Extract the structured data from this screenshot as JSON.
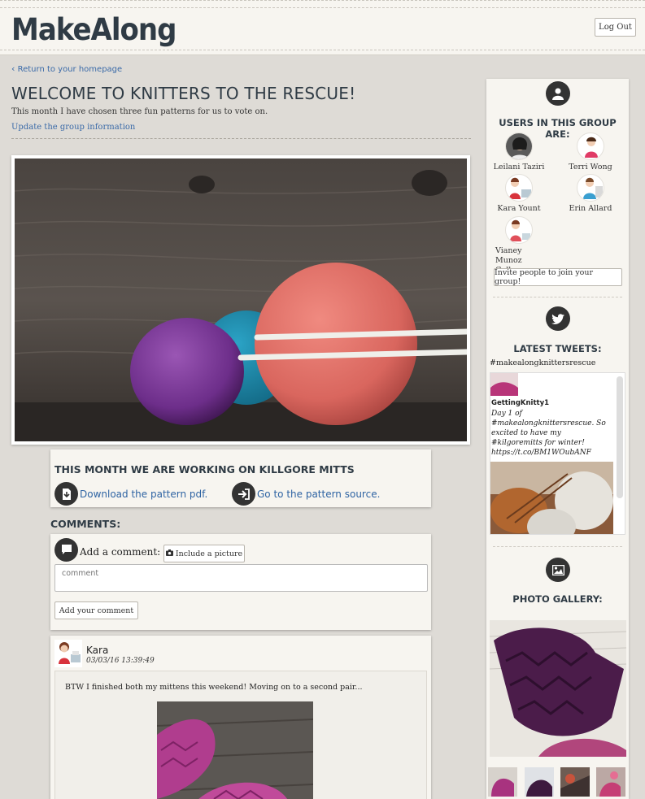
{
  "header": {
    "logo": "MakeAlong",
    "logout_label": "Log Out"
  },
  "nav": {
    "back_label": "Return to your homepage"
  },
  "group": {
    "title": "WELCOME TO KNITTERS TO THE RESCUE!",
    "intro": "This month I have chosen three fun patterns for us to vote on.",
    "update_link": "Update the group information"
  },
  "project": {
    "title": "THIS MONTH WE ARE WORKING ON KILLGORE MITTS",
    "download_label": "Download the pattern pdf.",
    "source_label": "Go to the pattern source."
  },
  "comments": {
    "heading": "COMMENTS:",
    "add_label": "Add a comment:",
    "include_picture_label": "Include a picture",
    "placeholder": "comment",
    "submit_label": "Add your comment",
    "posts": [
      {
        "author": "Kara",
        "timestamp": "03/03/16 13:39:49",
        "text": "BTW I finished both my mittens this weekend! Moving on to a second pair..."
      }
    ]
  },
  "sidebar": {
    "users_heading": "USERS IN THIS GROUP ARE:",
    "members": [
      "Leilani Taziri",
      "Terri Wong",
      "Kara Yount",
      "Erin Allard",
      "Vianey Munoz Gallegos"
    ],
    "invite_label": "Invite people to join your group!",
    "tweets_heading": "LATEST TWEETS:",
    "hashtag": "#makealongknittersrescue",
    "tweet": {
      "author": "GettingKnitty1",
      "text": "Day 1 of #makealongknittersrescue. So excited to have my #kilgoremitts for winter! https://t.co/BM1WOubANF"
    },
    "gallery_heading": "PHOTO GALLERY:"
  },
  "colors": {
    "accent": "#2f64a3",
    "background": "#dedbd6",
    "panel": "#f7f5f0",
    "heading": "#2f3b45"
  }
}
